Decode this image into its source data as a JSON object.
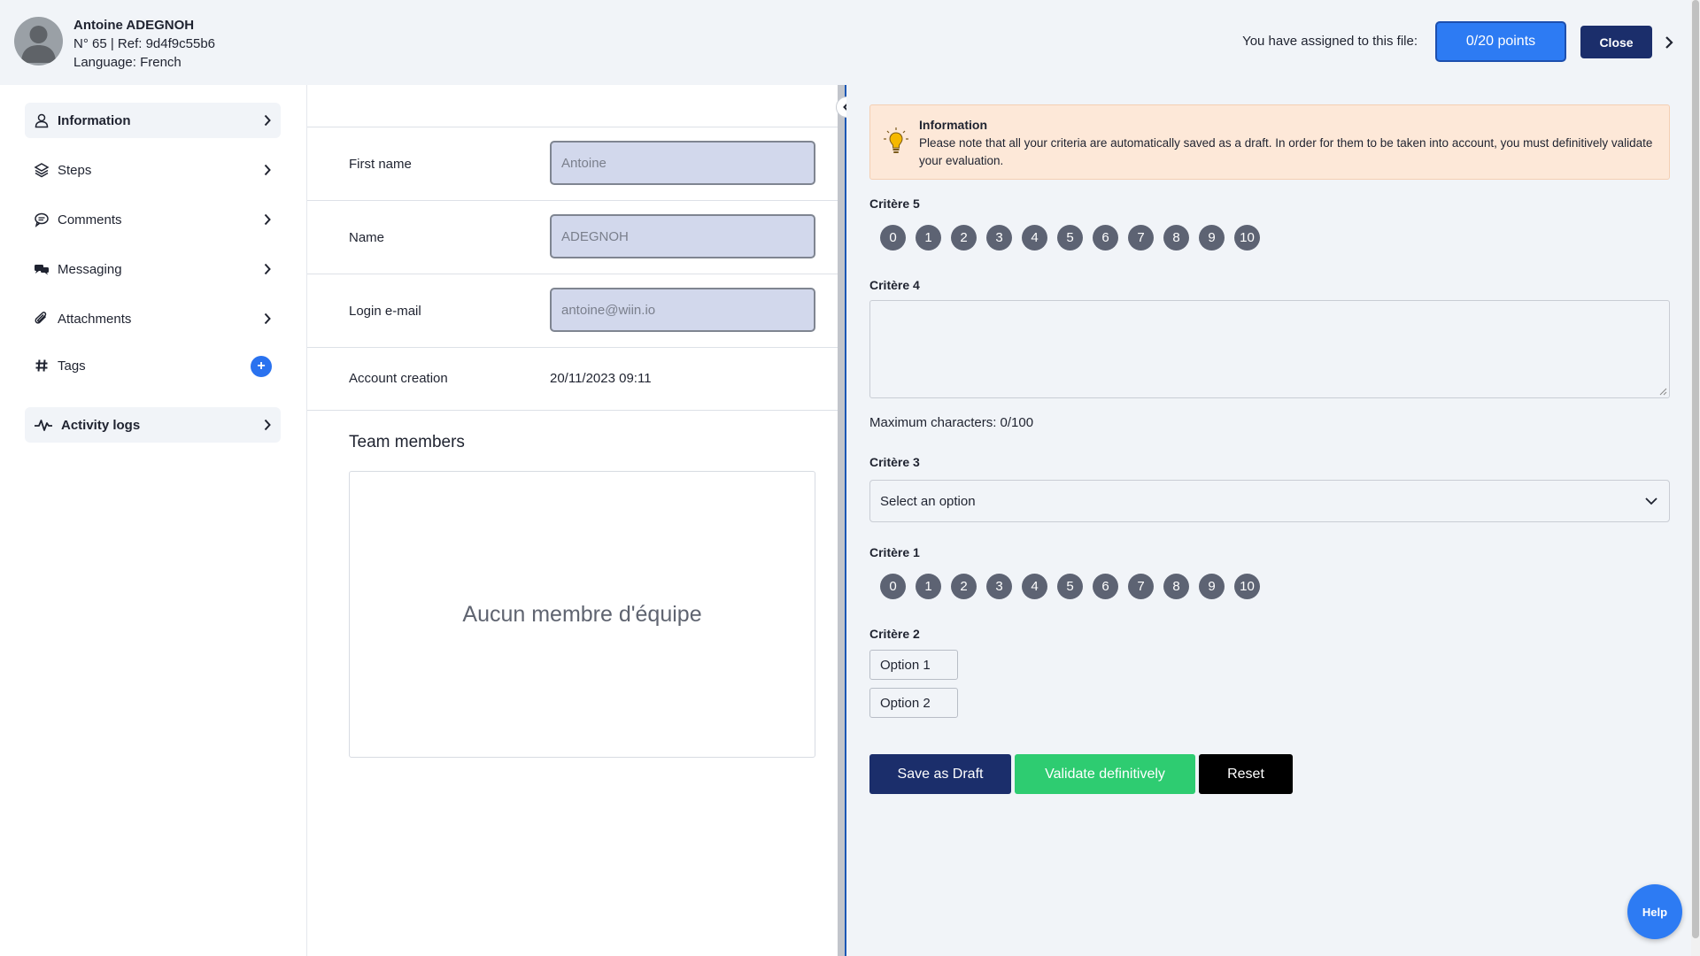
{
  "header": {
    "user_name": "Antoine ADEGNOH",
    "user_ref": "N° 65 | Ref: 9d4f9c55b6",
    "user_language": "Language: French",
    "assigned_label": "You have assigned to this file:",
    "points_label": "0/20 points",
    "close_label": "Close"
  },
  "sidebar": {
    "items": [
      {
        "label": "Information",
        "icon": "user-icon"
      },
      {
        "label": "Steps",
        "icon": "layers-icon"
      },
      {
        "label": "Comments",
        "icon": "comment-icon"
      },
      {
        "label": "Messaging",
        "icon": "messaging-icon"
      },
      {
        "label": "Attachments",
        "icon": "paperclip-icon"
      },
      {
        "label": "Tags",
        "icon": "hash-icon"
      },
      {
        "label": "Activity logs",
        "icon": "activity-icon"
      }
    ],
    "tags_add": "+"
  },
  "profile": {
    "first_name_label": "First name",
    "first_name_value": "Antoine",
    "name_label": "Name",
    "name_value": "ADEGNOH",
    "login_label": "Login e-mail",
    "login_value": "antoine@wiin.io",
    "account_creation_label": "Account creation",
    "account_creation_value": "20/11/2023 09:11",
    "team_title": "Team members",
    "team_empty": "Aucun membre d'équipe"
  },
  "evaluation": {
    "info_title": "Information",
    "info_text": "Please note that all your criteria are automatically saved as a draft. In order for them to be taken into account, you must definitively validate your evaluation.",
    "criteria5_label": "Critère 5",
    "criteria4_label": "Critère 4",
    "max_chars": "Maximum characters: 0/100",
    "criteria3_label": "Critère 3",
    "select_placeholder": "Select an option",
    "criteria1_label": "Critère 1",
    "criteria2_label": "Critère 2",
    "option1": "Option 1",
    "option2": "Option 2",
    "scores": [
      "0",
      "1",
      "2",
      "3",
      "4",
      "5",
      "6",
      "7",
      "8",
      "9",
      "10"
    ],
    "save_draft": "Save as Draft",
    "validate": "Validate definitively",
    "reset": "Reset"
  },
  "help_label": "Help",
  "colors": {
    "primary": "#2d7bf3",
    "navy": "#1b2e6b",
    "success": "#2ecc71",
    "info_bg": "#fde8d8"
  }
}
